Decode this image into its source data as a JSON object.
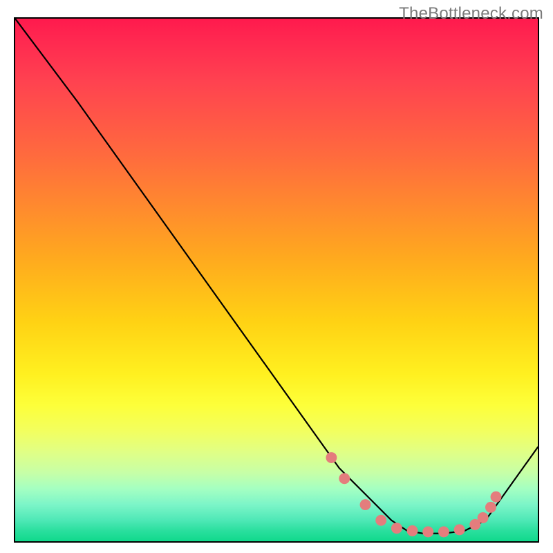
{
  "watermark": "TheBottleneck.com",
  "chart_data": {
    "type": "line",
    "title": "",
    "xlabel": "",
    "ylabel": "",
    "xlim": [
      0,
      100
    ],
    "ylim": [
      0,
      100
    ],
    "series": [
      {
        "name": "curve",
        "x": [
          0,
          12,
          62,
          68,
          72,
          75,
          78,
          82,
          86,
          90,
          100
        ],
        "y": [
          100,
          84,
          14,
          8,
          4,
          2,
          1.5,
          1.5,
          2,
          4,
          18
        ]
      }
    ],
    "markers": {
      "name": "valley-points",
      "color": "#e47d7d",
      "points": [
        {
          "x": 60.5,
          "y": 16
        },
        {
          "x": 63,
          "y": 12
        },
        {
          "x": 67,
          "y": 7
        },
        {
          "x": 70,
          "y": 4
        },
        {
          "x": 73,
          "y": 2.5
        },
        {
          "x": 76,
          "y": 2
        },
        {
          "x": 79,
          "y": 1.8
        },
        {
          "x": 82,
          "y": 1.8
        },
        {
          "x": 85,
          "y": 2.2
        },
        {
          "x": 88,
          "y": 3.2
        },
        {
          "x": 89.5,
          "y": 4.5
        },
        {
          "x": 91,
          "y": 6.5
        },
        {
          "x": 92,
          "y": 8.5
        }
      ]
    },
    "background": {
      "type": "vertical-gradient",
      "stops": [
        {
          "pos": 0,
          "color": "#ff1a4d"
        },
        {
          "pos": 50,
          "color": "#ffc400"
        },
        {
          "pos": 75,
          "color": "#fcff3a"
        },
        {
          "pos": 100,
          "color": "#10d98c"
        }
      ]
    }
  }
}
